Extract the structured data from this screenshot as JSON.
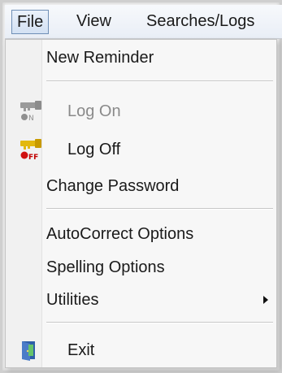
{
  "menubar": {
    "file": "File",
    "view": "View",
    "searches_logs": "Searches/Logs"
  },
  "file_menu": {
    "new_reminder": "New Reminder",
    "log_on": "Log On",
    "log_off": "Log Off",
    "change_password": "Change Password",
    "autocorrect_options": "AutoCorrect Options",
    "spelling_options": "Spelling Options",
    "utilities": "Utilities",
    "exit": "Exit"
  },
  "icons": {
    "log_on": "key-on-icon",
    "log_off": "key-off-icon",
    "exit": "exit-door-icon",
    "utilities_submenu": "submenu-arrow-icon"
  },
  "colors": {
    "menu_background": "#f7f7f7",
    "active_menu_border": "#6f8fb6",
    "disabled_text": "#8a8a8a"
  },
  "state": {
    "log_on_disabled": true
  }
}
